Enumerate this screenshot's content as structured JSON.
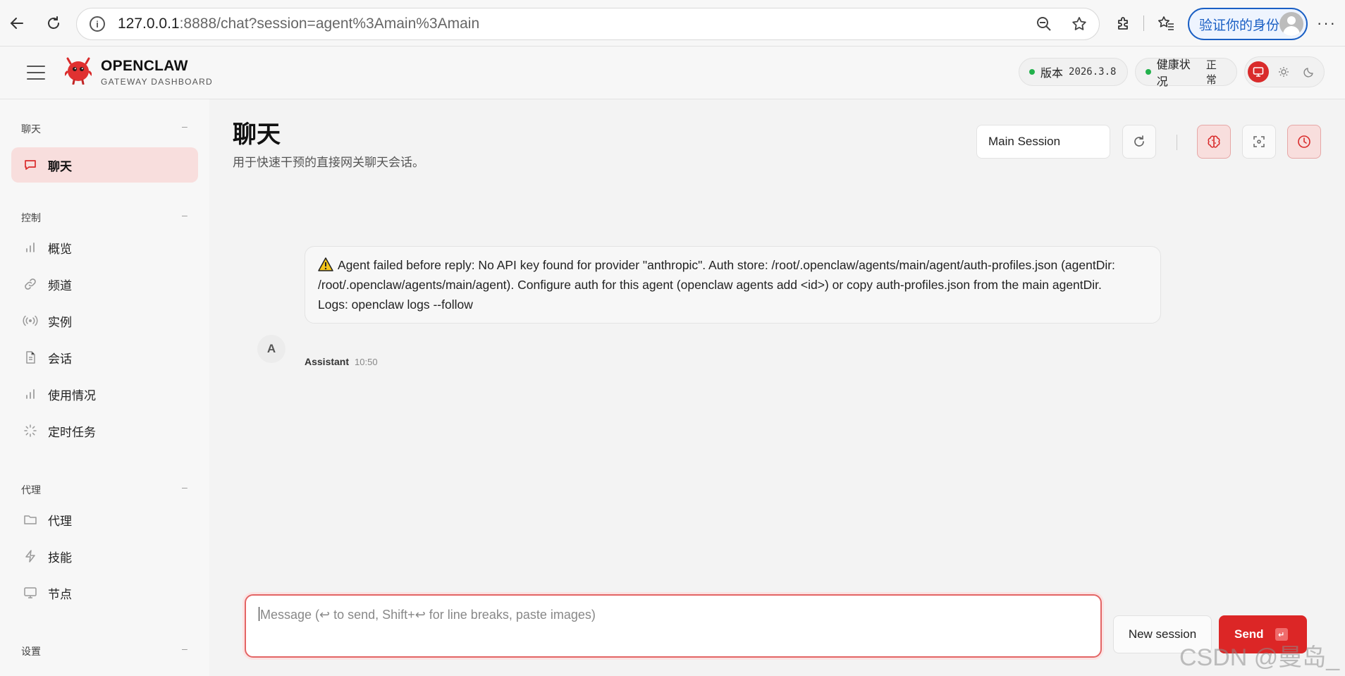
{
  "browser": {
    "url_host": "127.0.0.1",
    "url_rest": ":8888/chat?session=agent%3Amain%3Amain",
    "verify_label": "验证你的身份"
  },
  "header": {
    "brand_title": "OPENCLAW",
    "brand_subtitle": "GATEWAY DASHBOARD",
    "version_label": "版本",
    "version_value": "2026.3.8",
    "health_label": "健康状况",
    "health_value": "正常"
  },
  "sidebar": {
    "sections": [
      {
        "label": "聊天",
        "collapse": "–"
      },
      {
        "label": "控制",
        "collapse": "–"
      },
      {
        "label": "代理",
        "collapse": "–"
      },
      {
        "label": "设置",
        "collapse": "–"
      }
    ],
    "items": [
      {
        "label": "聊天",
        "icon": "chat-bubble-icon"
      },
      {
        "label": "概览",
        "icon": "bar-chart-icon"
      },
      {
        "label": "频道",
        "icon": "link-icon"
      },
      {
        "label": "实例",
        "icon": "radio-icon"
      },
      {
        "label": "会话",
        "icon": "document-icon"
      },
      {
        "label": "使用情况",
        "icon": "bar-chart-icon"
      },
      {
        "label": "定时任务",
        "icon": "loader-icon"
      },
      {
        "label": "代理",
        "icon": "folder-icon"
      },
      {
        "label": "技能",
        "icon": "lightning-icon"
      },
      {
        "label": "节点",
        "icon": "monitor-icon"
      }
    ]
  },
  "main": {
    "title": "聊天",
    "subtitle": "用于快速干预的直接网关聊天会话。",
    "session_select": "Main Session",
    "message": {
      "avatar": "A",
      "lines": [
        "Agent failed before reply: No API key found for provider \"anthropic\". Auth store: /root/.openclaw/agents/main/agent/auth-profiles.json (agentDir: /root/.openclaw/agents/main/agent). Configure auth for this agent (openclaw agents add <id>) or copy auth-profiles.json from the main agentDir.",
        "Logs: openclaw logs --follow"
      ],
      "sender": "Assistant",
      "time": "10:50"
    },
    "composer_placeholder": "Message (↩ to send, Shift+↩ for line breaks, paste images)",
    "new_session_label": "New session",
    "send_label": "Send",
    "send_kbd": "↵"
  },
  "watermark": "CSDN @曼岛_",
  "colors": {
    "accent": "#dc2626",
    "active_bg": "#f8dedd",
    "status_ok": "#22b14c"
  }
}
